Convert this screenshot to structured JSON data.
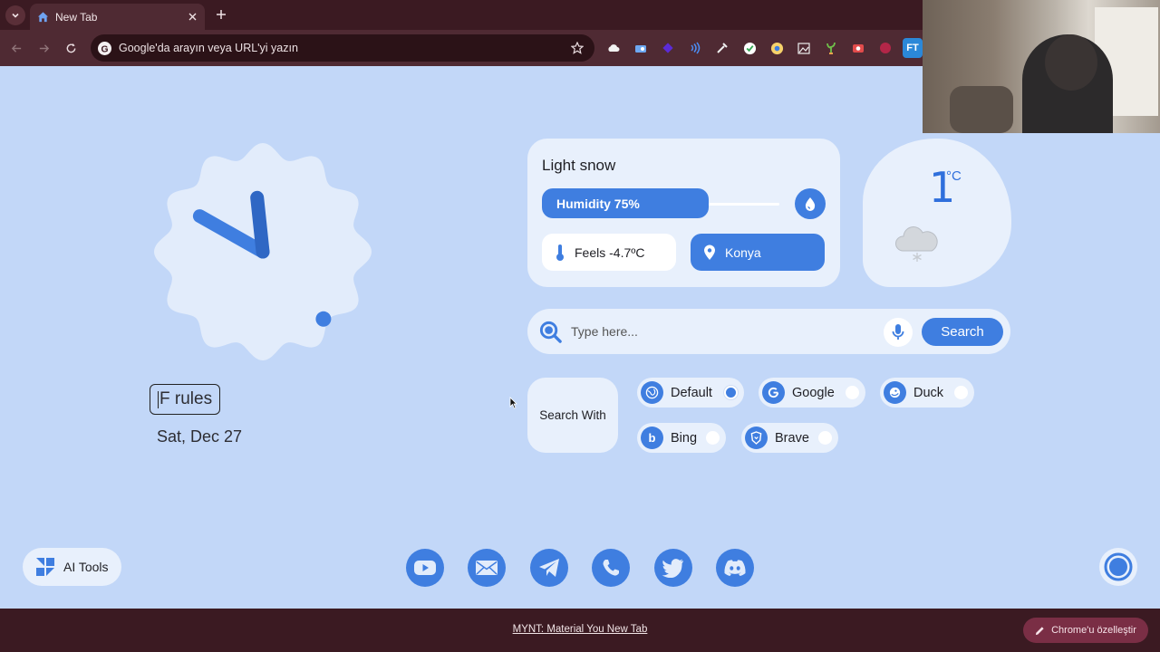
{
  "browser": {
    "tab_title": "New Tab",
    "omnibox_placeholder": "Google'da arayın veya URL'yi yazın"
  },
  "clock": {
    "hour": 9,
    "minute": 59,
    "second": 23
  },
  "date": {
    "editable_text": "F rules",
    "date_label": "Sat, Dec 27"
  },
  "weather": {
    "condition": "Light snow",
    "humidity_label": "Humidity 75%",
    "humidity_value": 75,
    "feels_label": "Feels -4.7ºC",
    "location": "Konya",
    "temperature": "1",
    "unit": "°C"
  },
  "search": {
    "placeholder": "Type here...",
    "button_label": "Search",
    "search_with_label": "Search With",
    "engines": [
      {
        "label": "Default",
        "selected": true
      },
      {
        "label": "Google",
        "selected": false
      },
      {
        "label": "Duck",
        "selected": false
      },
      {
        "label": "Bing",
        "selected": false
      },
      {
        "label": "Brave",
        "selected": false
      }
    ]
  },
  "bottom": {
    "ai_tools_label": "AI Tools",
    "social_icons": [
      "youtube-icon",
      "mail-icon",
      "telegram-icon",
      "whatsapp-icon",
      "twitter-icon",
      "discord-icon"
    ]
  },
  "footer": {
    "link_text": "MYNT: Material You New Tab",
    "customize_label": "Chrome'u özelleştir"
  },
  "colors": {
    "background": "#c2d7f8",
    "card": "#e8f0fc",
    "accent": "#3f7ee0",
    "chrome_dark": "#3b1a22",
    "chrome_toolbar": "#4f2a33"
  }
}
